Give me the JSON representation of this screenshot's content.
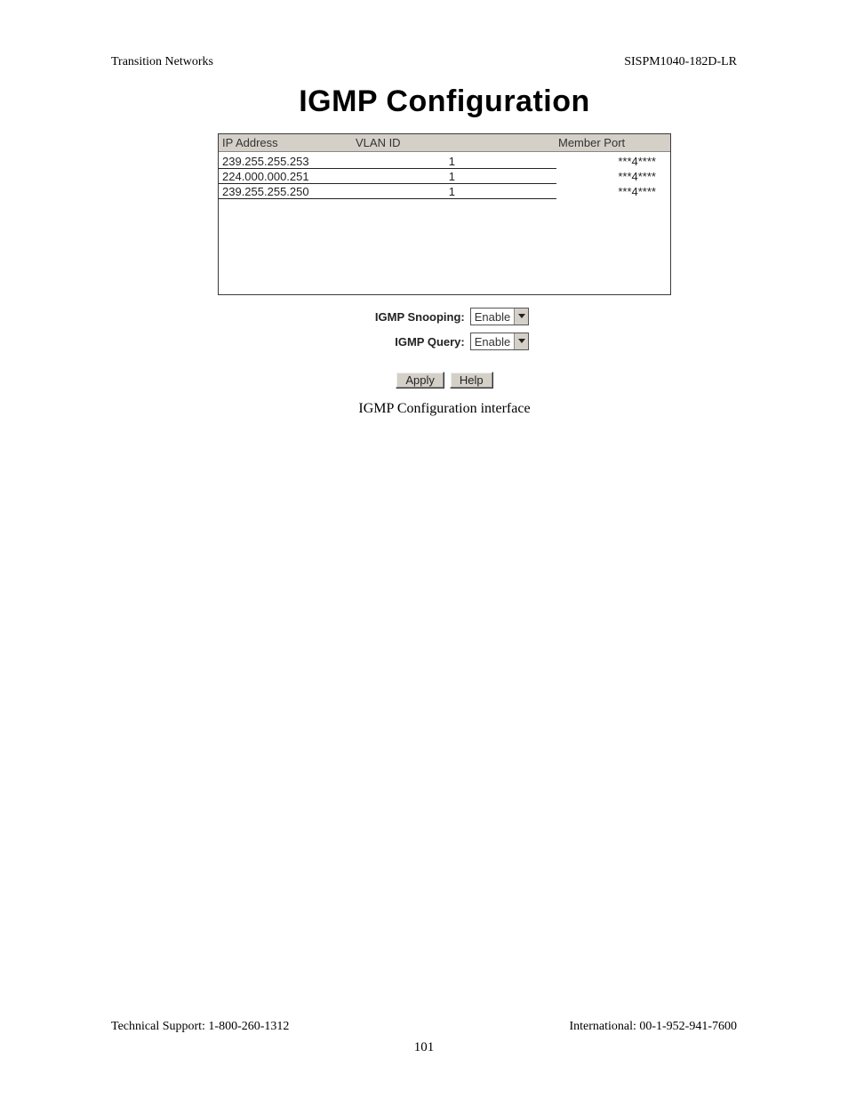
{
  "header": {
    "left": "Transition Networks",
    "right": "SISPM1040-182D-LR"
  },
  "main": {
    "title": "IGMP Configuration",
    "table": {
      "columns": {
        "ip": "IP Address",
        "vlan": "VLAN ID",
        "port": "Member Port"
      },
      "rows": [
        {
          "ip": "239.255.255.253",
          "vlan": "1",
          "port": "***4****"
        },
        {
          "ip": "224.000.000.251",
          "vlan": "1",
          "port": "***4****"
        },
        {
          "ip": "239.255.255.250",
          "vlan": "1",
          "port": "***4****"
        }
      ]
    },
    "form": {
      "snooping_label": "IGMP Snooping:",
      "snooping_value": "Enable",
      "query_label": "IGMP Query:",
      "query_value": "Enable"
    },
    "buttons": {
      "apply": "Apply",
      "help": "Help"
    },
    "caption": "IGMP Configuration interface"
  },
  "footer": {
    "left": "Technical Support: 1-800-260-1312",
    "right": "International: 00-1-952-941-7600",
    "page_number": "101"
  }
}
